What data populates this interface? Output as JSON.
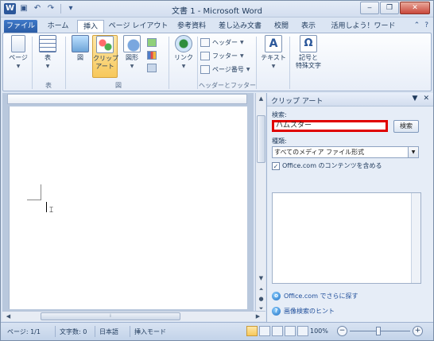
{
  "app": {
    "title": "文書 1 - Microsoft Word",
    "logo_letter": "W"
  },
  "window_controls": {
    "minimize": "‒",
    "restore": "❐",
    "close": "✕"
  },
  "tabs": [
    {
      "label": "ファイル"
    },
    {
      "label": "ホーム"
    },
    {
      "label": "挿入"
    },
    {
      "label": "ページ レイアウト"
    },
    {
      "label": "参考資料"
    },
    {
      "label": "差し込み文書"
    },
    {
      "label": "校閲"
    },
    {
      "label": "表示"
    },
    {
      "label": "活用しよう！ワード"
    }
  ],
  "ribbon": {
    "page_label": "ページ",
    "table_label": "表",
    "picture_label": "図",
    "clipart_label": "クリップ\nアート",
    "shapes_label": "図形",
    "link_label": "リンク",
    "header_label": "ヘッダー",
    "footer_label": "フッター",
    "pagenum_label": "ページ番号",
    "textbox_label": "テキスト",
    "symbol_label": "記号と\n特殊文字",
    "group_table": "表",
    "group_illust": "図",
    "group_headerfooter": "ヘッダーとフッター",
    "symbol_glyph": "Ω"
  },
  "pane": {
    "title": "クリップ アート",
    "search_label": "検索:",
    "search_value": "ハムスター",
    "search_button": "検索",
    "type_label": "種類:",
    "type_value": "すべてのメディア ファイル形式",
    "checkbox_label": "Office.com のコンテンツを含める",
    "checkbox_checked": true,
    "link_more": "Office.com でさらに探す",
    "link_hint": "画像検索のヒント"
  },
  "status": {
    "page": "ページ: 1/1",
    "words": "文字数: 0",
    "language": "日本語",
    "mode": "挿入モード",
    "zoom": "100%"
  },
  "colors": {
    "accent": "#2b579a",
    "highlight_border": "#e00000",
    "selected_button": "#f7c85b"
  }
}
